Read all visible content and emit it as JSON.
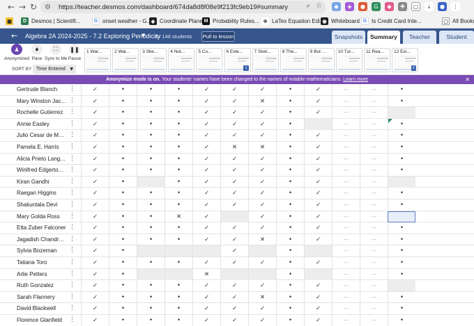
{
  "browser": {
    "url": "https://teacher.desmos.com/dashboard/674da8d8f08e9f213fc9eb19#summary",
    "bookmarks": [
      {
        "label": "Desmos | Scientifi...",
        "color": "#2e7d4f",
        "glyph": "D"
      },
      {
        "label": "onset weather - G...",
        "color": "#ffffff",
        "glyph": "G"
      },
      {
        "label": "Coordinate Plane",
        "color": "#222222",
        "glyph": "◆"
      },
      {
        "label": "Probability Rules...",
        "color": "#111111",
        "glyph": "M"
      },
      {
        "label": "LaTex Equation Edi...",
        "color": "#666666",
        "glyph": "✤"
      },
      {
        "label": "Whiteboard",
        "color": "#222222",
        "glyph": "◉"
      },
      {
        "label": "Is Credit Card Inte...",
        "color": "#ffffff",
        "glyph": "G"
      },
      {
        "label": "All Bookm",
        "color": "#ffffff",
        "glyph": "▢"
      }
    ]
  },
  "header": {
    "title": "Algebra 2A 2024-2025 - 7.2 Exploring Periodicity",
    "student_count": "3 / 148 students",
    "pull_to_lesson": "Pull to lesson",
    "tabs": [
      {
        "label": "Snapshots",
        "active": false
      },
      {
        "label": "Summary",
        "active": true
      },
      {
        "label": "Teacher",
        "active": false
      },
      {
        "label": "Student",
        "active": false
      }
    ]
  },
  "toolbar": {
    "tools": [
      {
        "label": "Anonymized",
        "icon": "anonymize-icon"
      },
      {
        "label": "Pace",
        "icon": "pace-icon"
      },
      {
        "label": "Sync to Me",
        "icon": "sync-icon"
      },
      {
        "label": "Pause",
        "icon": "pause-icon"
      }
    ],
    "sort_by_label": "SORT BY",
    "sort_value": "Time Entered"
  },
  "screens": [
    {
      "label": "1 War...",
      "badge": ""
    },
    {
      "label": "2 War...",
      "badge": ""
    },
    {
      "label": "3 Ske...",
      "badge": ""
    },
    {
      "label": "4 Not...",
      "badge": ""
    },
    {
      "label": "5 Co...",
      "badge": ""
    },
    {
      "label": "6 Exte...",
      "badge": "1"
    },
    {
      "label": "7 Sket...",
      "badge": ""
    },
    {
      "label": "8 The...",
      "badge": ""
    },
    {
      "label": "9 But ...",
      "badge": ""
    },
    {
      "label": "10 Tur...",
      "badge": ""
    },
    {
      "label": "11 Rea...",
      "badge": ""
    },
    {
      "label": "12 Exi...",
      "badge": "2"
    }
  ],
  "banner": {
    "bold": "Anonymize mode is on.",
    "text": " Your students' names have been changed to the names of notable mathematicians.",
    "link": "Learn more"
  },
  "students": [
    {
      "name": "Gertrude Blanch",
      "cells": [
        "✓",
        "•",
        "•",
        "•",
        "✓",
        "✓",
        "✓",
        "•",
        "✓",
        "—",
        "—",
        "•"
      ]
    },
    {
      "name": "Mary Winston Jack...",
      "cells": [
        "✓",
        "•",
        "•",
        "•",
        "✓",
        "✓",
        "✕",
        "•",
        "✓",
        "—",
        "—",
        "•"
      ]
    },
    {
      "name": "Rochelle Gutierrez",
      "cells": [
        "✓",
        "•",
        "•",
        "•",
        "✓",
        "✓",
        "✓",
        "•",
        "✓",
        "—",
        "—",
        ""
      ]
    },
    {
      "name": "Annie Easley",
      "cells": [
        "✓",
        "•",
        "•",
        "•",
        "✓",
        "✓",
        "✓",
        "•",
        "",
        "—",
        "—",
        "•"
      ]
    },
    {
      "name": "Julio Cesar de Mell...",
      "cells": [
        "✓",
        "•",
        "•",
        "•",
        "✓",
        "✓",
        "✓",
        "•",
        "✓",
        "—",
        "—",
        "•"
      ]
    },
    {
      "name": "Pamela E. Harris",
      "cells": [
        "✓",
        "•",
        "•",
        "•",
        "✓",
        "✕",
        "✕",
        "•",
        "✓",
        "—",
        "—",
        "•"
      ]
    },
    {
      "name": "Alicia Prieto Langar...",
      "cells": [
        "✓",
        "•",
        "•",
        "•",
        "✓",
        "✓",
        "✓",
        "•",
        "✓",
        "—",
        "—",
        "•"
      ]
    },
    {
      "name": "Winifred Edgerton ...",
      "cells": [
        "✓",
        "•",
        "•",
        "•",
        "✓",
        "✓",
        "✓",
        "•",
        "✓",
        "—",
        "—",
        "•"
      ]
    },
    {
      "name": "Kiran Gandhi",
      "cells": [
        "✓",
        "•",
        "",
        "•",
        "✓",
        "✓",
        "✓",
        "•",
        "✓",
        "—",
        "—",
        ""
      ]
    },
    {
      "name": "Raegan Higgins",
      "cells": [
        "✓",
        "•",
        "•",
        "•",
        "✓",
        "✓",
        "✓",
        "•",
        "✓",
        "—",
        "—",
        "•"
      ]
    },
    {
      "name": "Shakuntala Devi",
      "cells": [
        "✓",
        "•",
        "•",
        "•",
        "✓",
        "✓",
        "✓",
        "•",
        "✓",
        "—",
        "—",
        "•"
      ]
    },
    {
      "name": "Mary Golda Ross",
      "cells": [
        "✓",
        "•",
        "•",
        "✕",
        "✓",
        "",
        "✓",
        "•",
        "✓",
        "—",
        "—",
        "sel"
      ]
    },
    {
      "name": "Etta Zuber Falconer",
      "cells": [
        "✓",
        "•",
        "•",
        "•",
        "✓",
        "✓",
        "✓",
        "•",
        "✓",
        "—",
        "—",
        "•"
      ]
    },
    {
      "name": "Jagadish Chandra ...",
      "cells": [
        "✓",
        "•",
        "•",
        "•",
        "✓",
        "✓",
        "✕",
        "•",
        "✓",
        "—",
        "—",
        "•"
      ]
    },
    {
      "name": "Sylvia Bozeman",
      "cells": [
        "✓",
        "•",
        "",
        "",
        "",
        "✓",
        "",
        "•",
        "",
        "—",
        "—",
        "•"
      ]
    },
    {
      "name": "Tatiana Toro",
      "cells": [
        "✓",
        "•",
        "•",
        "•",
        "✓",
        "✓",
        "✓",
        "•",
        "✓",
        "—",
        "—",
        "•"
      ]
    },
    {
      "name": "Arlie Petters",
      "cells": [
        "✓",
        "•",
        "",
        "",
        "✕",
        "",
        "",
        "•",
        "",
        "—",
        "—",
        "•"
      ]
    },
    {
      "name": "Ruth Gonzalez",
      "cells": [
        "✓",
        "•",
        "•",
        "•",
        "✓",
        "✓",
        "✓",
        "•",
        "✓",
        "—",
        "—",
        ""
      ]
    },
    {
      "name": "Sarah Flannery",
      "cells": [
        "✓",
        "•",
        "•",
        "•",
        "✓",
        "✓",
        "✕",
        "•",
        "✓",
        "—",
        "—",
        "•"
      ]
    },
    {
      "name": "David Blackwell",
      "cells": [
        "✓",
        "•",
        "•",
        "•",
        "✓",
        "✓",
        "✓",
        "•",
        "✓",
        "—",
        "—",
        "•"
      ]
    },
    {
      "name": "Florence Glanfield",
      "cells": [
        "✓",
        "•",
        "•",
        "•",
        "✓",
        "✓",
        "✓",
        "•",
        "✓",
        "—",
        "—",
        "•"
      ]
    }
  ],
  "colors": {
    "header_blue": "#35558c",
    "banner_purple": "#7a4bb4",
    "anonymize_purple": "#6b44b0"
  }
}
